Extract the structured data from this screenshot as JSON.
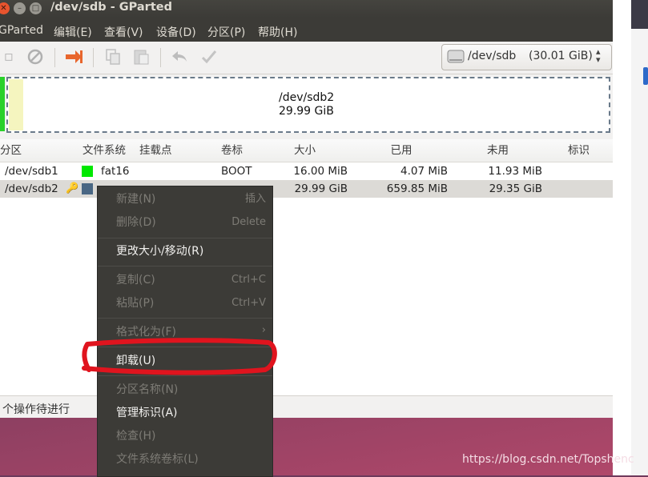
{
  "window": {
    "title": "/dev/sdb - GParted"
  },
  "menubar": {
    "items": [
      "GParted",
      "编辑(E)",
      "查看(V)",
      "设备(D)",
      "分区(P)",
      "帮助(H)"
    ]
  },
  "device_selector": {
    "label": "/dev/sdb",
    "size": "(30.01 GiB)"
  },
  "graph": {
    "name": "/dev/sdb2",
    "size": "29.99 GiB"
  },
  "table": {
    "headers": [
      "分区",
      "文件系统",
      "挂载点",
      "卷标",
      "大小",
      "已用",
      "未用",
      "标识"
    ],
    "rows": [
      {
        "partition": "/dev/sdb1",
        "fs": "fat16",
        "mount": "",
        "label": "BOOT",
        "size": "16.00 MiB",
        "used": "4.07 MiB",
        "unused": "11.93 MiB",
        "flags": "",
        "fs_color": "#00e800"
      },
      {
        "partition": "/dev/sdb2",
        "fs": "",
        "mount": "",
        "label": "",
        "size": "29.99 GiB",
        "used": "659.85 MiB",
        "unused": "29.35 GiB",
        "flags": "",
        "fs_color": "#4a6784"
      }
    ]
  },
  "statusbar": {
    "text": "个操作待进行"
  },
  "context_menu": {
    "items": [
      {
        "label": "新建(N)",
        "accel": "插入",
        "enabled": false
      },
      {
        "label": "删除(D)",
        "accel": "Delete",
        "enabled": false
      },
      {
        "label": "更改大小/移动(R)",
        "accel": "",
        "enabled": true
      },
      {
        "label": "复制(C)",
        "accel": "Ctrl+C",
        "enabled": false
      },
      {
        "label": "粘贴(P)",
        "accel": "Ctrl+V",
        "enabled": false
      },
      {
        "label": "格式化为(F)",
        "accel": "›",
        "enabled": false
      },
      {
        "label": "卸载(U)",
        "accel": "",
        "enabled": true
      },
      {
        "label": "分区名称(N)",
        "accel": "",
        "enabled": false
      },
      {
        "label": "管理标识(A)",
        "accel": "",
        "enabled": true
      },
      {
        "label": "检查(H)",
        "accel": "",
        "enabled": false
      },
      {
        "label": "文件系统卷标(L)",
        "accel": "",
        "enabled": false
      }
    ]
  },
  "watermark": "https://blog.csdn.net/Topshenc",
  "colors": {
    "annotation": "#e0141e",
    "menu_bg": "#3c3b37",
    "accent_orange": "#e8662d"
  },
  "icons": [
    "close-icon",
    "minimize-icon",
    "maximize-icon",
    "new-icon",
    "delete-icon",
    "apply-arrow-icon",
    "copy-icon",
    "paste-icon",
    "undo-icon",
    "check-icon",
    "disk-icon",
    "dropdown-arrow-icon",
    "lock-icon"
  ]
}
